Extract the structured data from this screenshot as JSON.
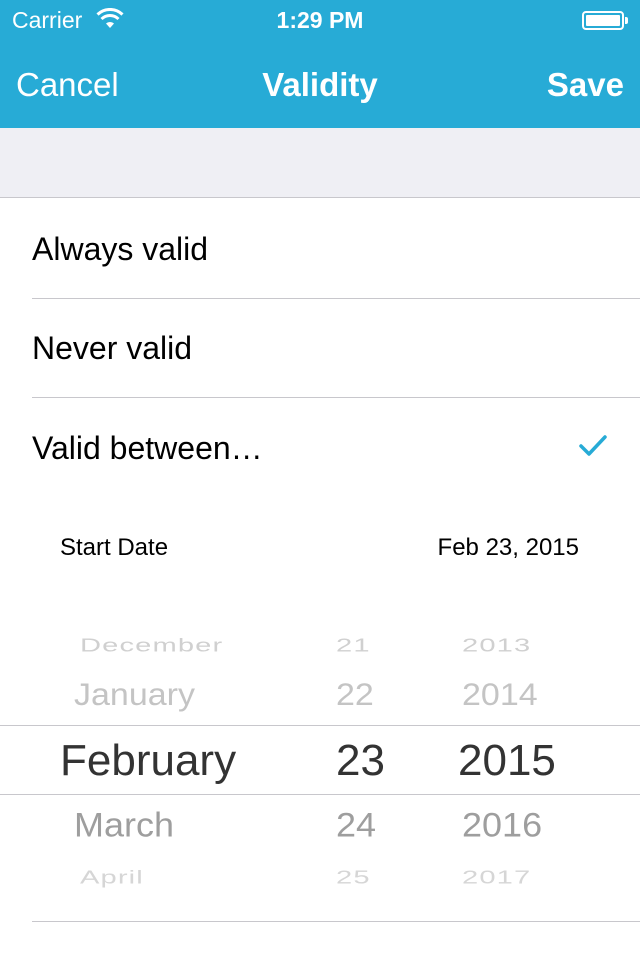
{
  "status_bar": {
    "carrier": "Carrier",
    "time": "1:29 PM",
    "battery_level": 1.0
  },
  "nav": {
    "cancel_label": "Cancel",
    "title": "Validity",
    "save_label": "Save"
  },
  "colors": {
    "accent": "#27abd6",
    "background_group": "#efeff4",
    "separator": "#c8c7cc"
  },
  "options": [
    {
      "label": "Always valid",
      "selected": false
    },
    {
      "label": "Never valid",
      "selected": false
    },
    {
      "label": "Valid between…",
      "selected": true
    }
  ],
  "start_date": {
    "label": "Start Date",
    "value": "Feb 23, 2015"
  },
  "picker": {
    "months": [
      "December",
      "January",
      "February",
      "March",
      "April"
    ],
    "days": [
      "21",
      "22",
      "23",
      "24",
      "25"
    ],
    "years": [
      "2013",
      "2014",
      "2015",
      "2016",
      "2017"
    ],
    "selected_index": 2
  }
}
